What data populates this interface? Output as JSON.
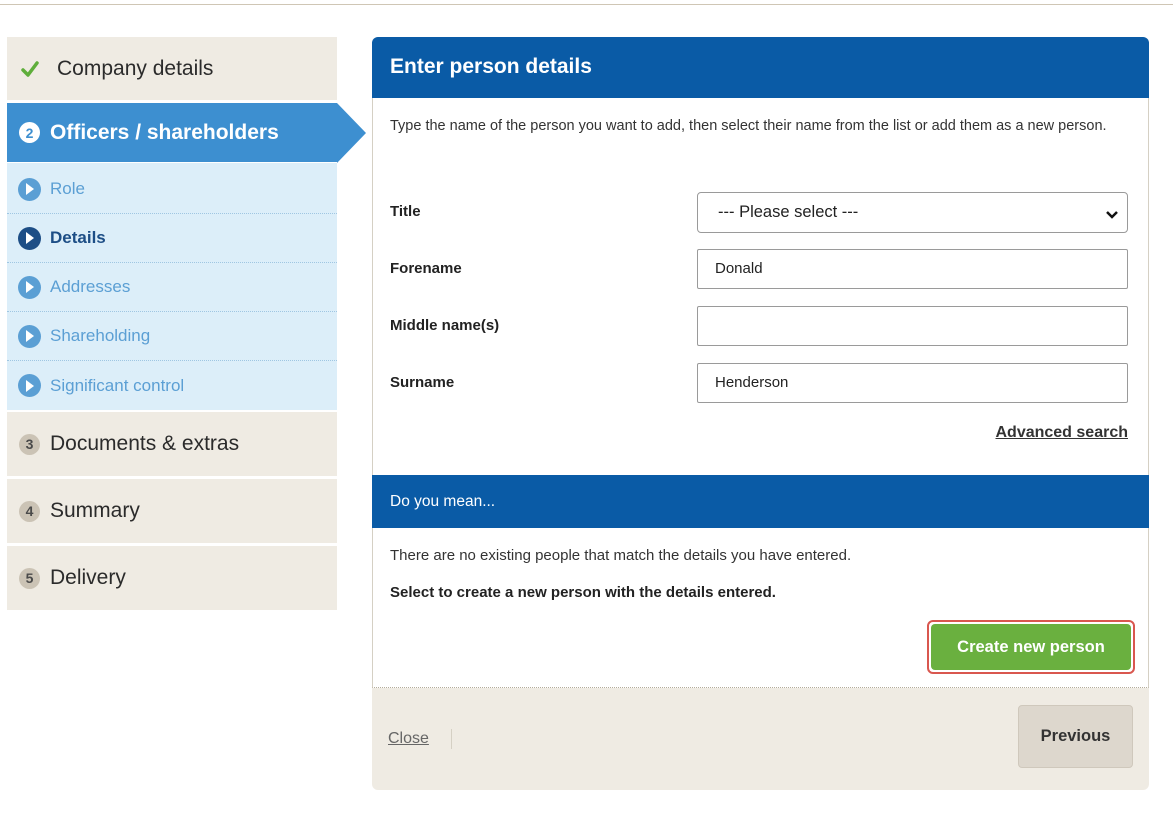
{
  "sidebar": {
    "steps": [
      {
        "label": "Company details",
        "state": "done"
      },
      {
        "num": "2",
        "label": "Officers / shareholders",
        "state": "active"
      },
      {
        "num": "3",
        "label": "Documents & extras"
      },
      {
        "num": "4",
        "label": "Summary"
      },
      {
        "num": "5",
        "label": "Delivery"
      }
    ],
    "substeps": [
      {
        "label": "Role"
      },
      {
        "label": "Details",
        "current": true
      },
      {
        "label": "Addresses"
      },
      {
        "label": "Shareholding"
      },
      {
        "label": "Significant control"
      }
    ]
  },
  "panel": {
    "title": "Enter person details",
    "intro": "Type the name of the person you want to add, then select their name from the list or add them as a new person.",
    "form": {
      "title_label": "Title",
      "title_value": "--- Please select ---",
      "forename_label": "Forename",
      "forename_value": "Donald",
      "middle_label": "Middle name(s)",
      "middle_value": "",
      "surname_label": "Surname",
      "surname_value": "Henderson"
    },
    "advanced_search": "Advanced search",
    "do_you_mean": "Do you mean...",
    "no_match": "There are no existing people that match the details you have entered.",
    "select_create": "Select to create a new person with the details entered.",
    "create_button": "Create new person",
    "close_link": "Close",
    "previous_button": "Previous"
  },
  "colors": {
    "brand_blue": "#0a5ba6",
    "active_step": "#3d8fd0",
    "create_green": "#6ab03f",
    "highlight_red": "#d9574f"
  },
  "icons": [
    "check-icon",
    "chevron-down-icon",
    "arrow-right-circle-icon"
  ]
}
